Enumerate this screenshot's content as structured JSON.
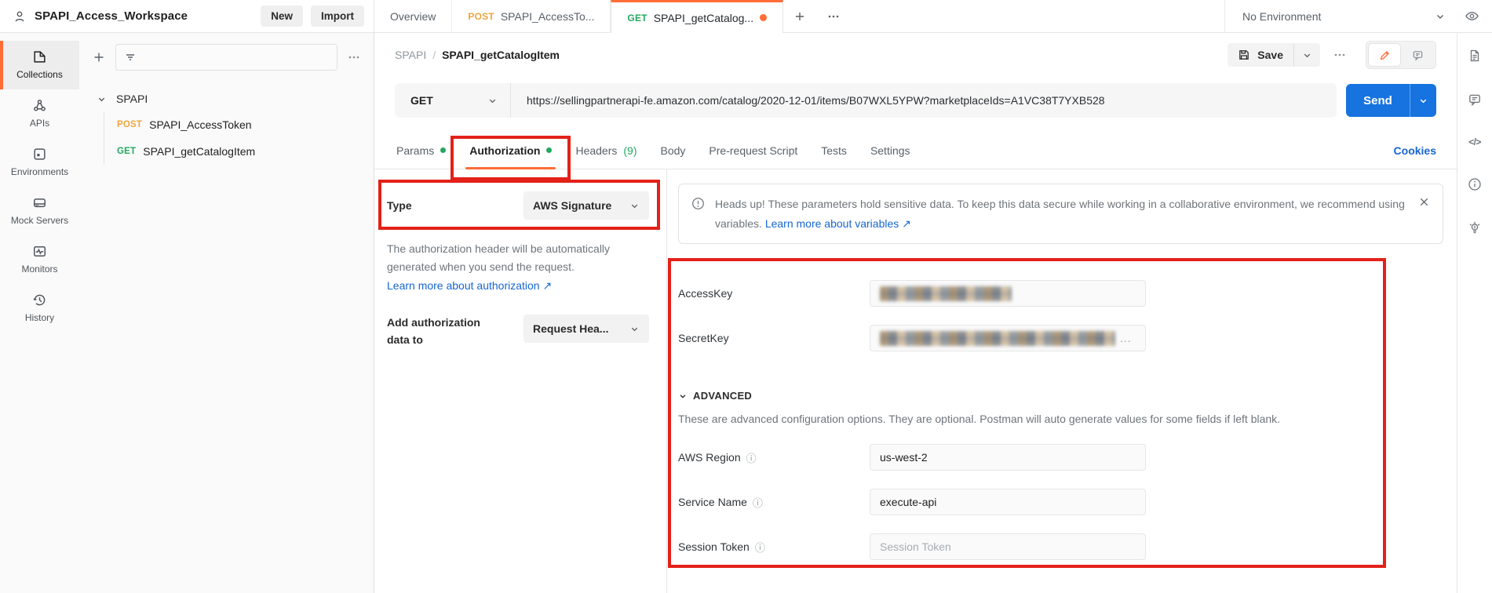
{
  "colors": {
    "brand_orange": "#ff6c37",
    "green": "#22a860",
    "post_amber": "#efa43e",
    "link_blue": "#1766d1",
    "send_blue": "#1673e0",
    "annotation_red": "#e32119"
  },
  "icons": {
    "person-icon": "user silhouette",
    "search-filter-icon": "filter lines",
    "more-icon": "3 dots",
    "plus-icon": "+",
    "chevron-down-icon": "v",
    "eye-icon": "eye",
    "save-icon": "floppy disk",
    "pencil-icon": "pencil",
    "comment-icon": "speech bubble",
    "document-icon": "file",
    "code-icon": "</>",
    "info-icon": "i in circle",
    "hint-icon": "lightbulb",
    "warning-icon": "! in circle",
    "close-icon": "x",
    "external-arrow": "↗"
  },
  "header": {
    "workspace_name": "SPAPI_Access_Workspace",
    "new_button": "New",
    "import_button": "Import",
    "tabs": [
      {
        "label": "Overview"
      },
      {
        "method": "POST",
        "label": "SPAPI_AccessTo..."
      },
      {
        "method": "GET",
        "label": "SPAPI_getCatalog..."
      }
    ],
    "environment": "No Environment"
  },
  "sidebar": {
    "items": [
      {
        "label": "Collections"
      },
      {
        "label": "APIs"
      },
      {
        "label": "Environments"
      },
      {
        "label": "Mock Servers"
      },
      {
        "label": "Monitors"
      },
      {
        "label": "History"
      }
    ]
  },
  "collections_panel": {
    "collection_name": "SPAPI",
    "requests": [
      {
        "method": "POST",
        "name": "SPAPI_AccessToken"
      },
      {
        "method": "GET",
        "name": "SPAPI_getCatalogItem"
      }
    ]
  },
  "request_editor": {
    "breadcrumb": {
      "collection": "SPAPI",
      "separator": "/",
      "request": "SPAPI_getCatalogItem"
    },
    "save_label": "Save",
    "method": "GET",
    "url": "https://sellingpartnerapi-fe.amazon.com/catalog/2020-12-01/items/B07WXL5YPW?marketplaceIds=A1VC38T7YXB528",
    "send_label": "Send",
    "tabs": {
      "params": "Params",
      "authorization": "Authorization",
      "headers": "Headers",
      "headers_count": "(9)",
      "body": "Body",
      "prerequest": "Pre-request Script",
      "tests": "Tests",
      "settings": "Settings"
    },
    "cookies_link": "Cookies"
  },
  "authorization": {
    "type_label": "Type",
    "type_value": "AWS Signature",
    "description": "The authorization header will be automatically generated when you send the request.",
    "learn_more_link": "Learn more about authorization ↗",
    "add_to_label": "Add authorization data to",
    "add_to_value": "Request Hea...",
    "banner": {
      "text": "Heads up! These parameters hold sensitive data. To keep this data secure while working in a collaborative environment, we recommend using variables. ",
      "link": "Learn more about variables ↗"
    },
    "fields": [
      {
        "label": "AccessKey",
        "value": "[redacted]"
      },
      {
        "label": "SecretKey",
        "value": "[redacted]",
        "suffix": "..."
      }
    ],
    "advanced": {
      "title": "ADVANCED",
      "description": "These are advanced configuration options. They are optional. Postman will auto generate values for some fields if left blank.",
      "fields": [
        {
          "label": "AWS Region",
          "value": "us-west-2"
        },
        {
          "label": "Service Name",
          "value": "execute-api"
        },
        {
          "label": "Session Token",
          "value": "",
          "placeholder": "Session Token"
        }
      ]
    }
  }
}
